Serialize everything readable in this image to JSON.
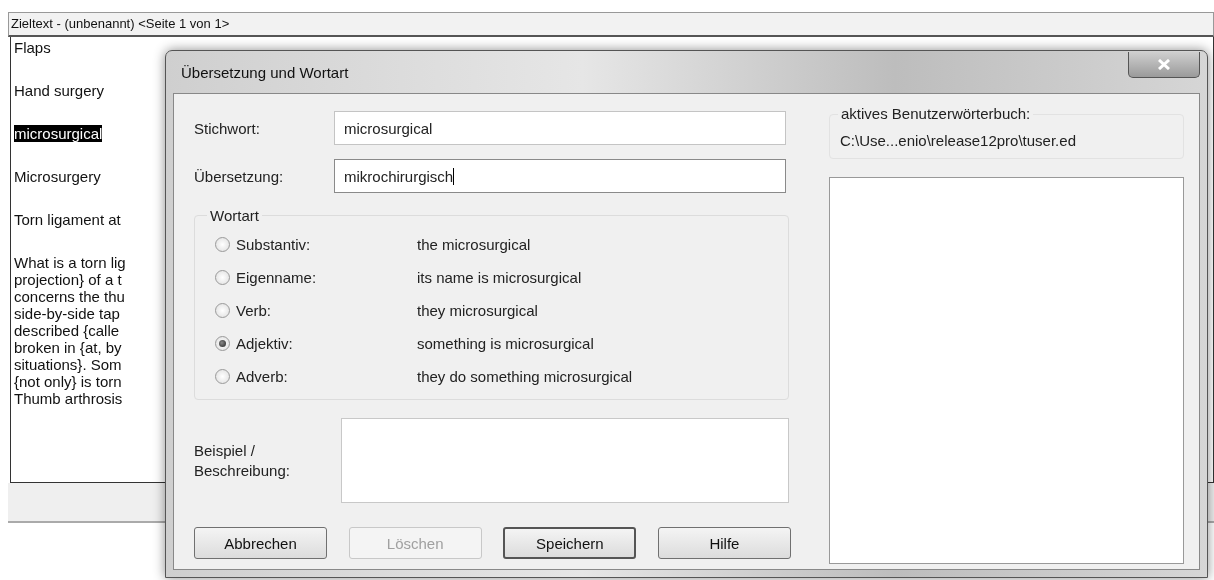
{
  "editor": {
    "title": "Zieltext - (unbenannt) <Seite 1 von 1>",
    "paragraphs": [
      {
        "lines": [
          "Flaps"
        ],
        "selected": false
      },
      {
        "lines": [
          "Hand surgery"
        ],
        "selected": false
      },
      {
        "lines": [
          "microsurgical"
        ],
        "selected": true
      },
      {
        "lines": [
          "Microsurgery"
        ],
        "selected": false
      },
      {
        "lines": [
          "Torn ligament at"
        ],
        "selected": false
      },
      {
        "lines": [
          "What is a torn lig",
          "projection} of a t",
          "concerns the thu",
          "side-by-side tap",
          "described {calle",
          "broken in {at, by",
          "situations}. Som",
          "{not only} is torn",
          "Thumb arthrosis"
        ],
        "selected": false
      }
    ]
  },
  "dialog": {
    "title": "Übersetzung und Wortart",
    "fields": [
      {
        "label": "Stichwort:",
        "value": "microsurgical",
        "focused": false
      },
      {
        "label": "Übersetzung:",
        "value": "mikrochirurgisch",
        "focused": true
      }
    ],
    "word_class": {
      "title": "Wortart",
      "options": [
        {
          "label": "Substantiv:",
          "example": "the microsurgical",
          "selected": false
        },
        {
          "label": "Eigenname:",
          "example": "its name is microsurgical",
          "selected": false
        },
        {
          "label": "Verb:",
          "example": "they microsurgical",
          "selected": false
        },
        {
          "label": "Adjektiv:",
          "example": "something is microsurgical",
          "selected": true
        },
        {
          "label": "Adverb:",
          "example": "they do something microsurgical",
          "selected": false
        }
      ]
    },
    "example": {
      "label": "Beispiel / Beschreibung:"
    },
    "buttons": [
      {
        "label": "Abbrechen",
        "disabled": false,
        "default": false
      },
      {
        "label": "Löschen",
        "disabled": true,
        "default": false
      },
      {
        "label": "Speichern",
        "disabled": false,
        "default": true
      },
      {
        "label": "Hilfe",
        "disabled": false,
        "default": false
      }
    ],
    "dictionary": {
      "title": "aktives Benutzerwörterbuch:",
      "path": "C:\\Use...enio\\release12pro\\tuser.ed"
    }
  }
}
